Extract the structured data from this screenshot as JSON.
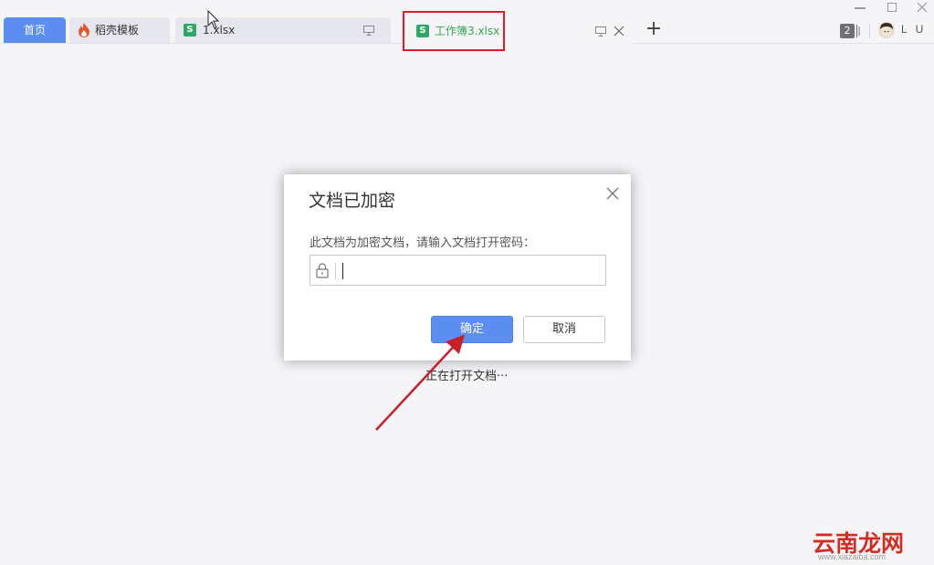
{
  "tabs": {
    "home": "首页",
    "templates": "稻壳模板",
    "file1": "1.xlsx",
    "active": "工作簿3.xlsx",
    "new_tab": "+"
  },
  "header": {
    "tab_count": "2",
    "username": "L U"
  },
  "status": {
    "opening": "正在打开文档···"
  },
  "dialog": {
    "title": "文档已加密",
    "message": "此文档为加密文档，请输入文档打开密码：",
    "password_value": "",
    "ok_label": "确定",
    "cancel_label": "取消"
  },
  "watermark": {
    "text": "云南龙网",
    "url": "www.xiazaiba.com"
  },
  "colors": {
    "accent": "#5b8ef0",
    "sheet_green": "#2fa866",
    "annotation_red": "#d81f26"
  }
}
